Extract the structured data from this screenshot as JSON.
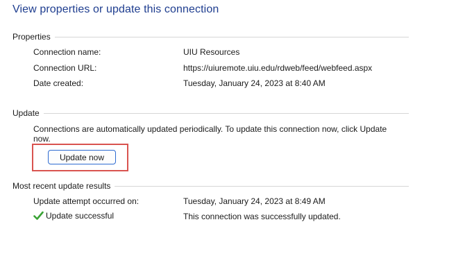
{
  "page": {
    "title": "View properties or update this connection"
  },
  "properties": {
    "section_title": "Properties",
    "rows": [
      {
        "label": "Connection name:",
        "value": "UIU Resources"
      },
      {
        "label": "Connection URL:",
        "value": "https://uiuremote.uiu.edu/rdweb/feed/webfeed.aspx"
      },
      {
        "label": "Date created:",
        "value": "Tuesday, January 24, 2023 at 8:40 AM"
      }
    ]
  },
  "update": {
    "section_title": "Update",
    "description": "Connections are automatically updated periodically.  To update this connection now, click Update now.",
    "button_label": "Update now"
  },
  "results": {
    "section_title": "Most recent update results",
    "attempt_label": "Update attempt occurred on:",
    "attempt_value": "Tuesday, January 24, 2023 at 8:49 AM",
    "status_label": "Update successful",
    "status_value": "This connection was successfully updated.",
    "status_icon": "checkmark-icon",
    "status_color": "#3aa335"
  },
  "colors": {
    "title": "#1e3d8f",
    "highlight": "#d9534f",
    "button_border": "#2d6bd1"
  }
}
